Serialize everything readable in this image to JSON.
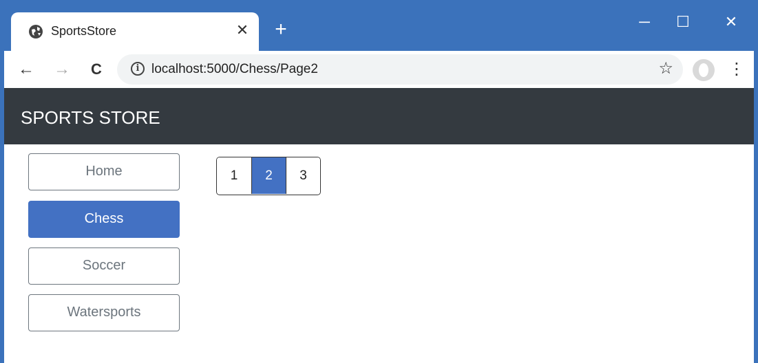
{
  "browser": {
    "tab_title": "SportsStore",
    "tab_close": "✕",
    "new_tab": "+",
    "url": "localhost:5000/Chess/Page2",
    "window_controls": {
      "minimize": "─",
      "maximize": "☐",
      "close": "✕"
    },
    "nav": {
      "back": "←",
      "forward": "→",
      "reload": "C"
    },
    "info_glyph": "i",
    "star_glyph": "☆",
    "menu_glyph": "⋮",
    "colors": {
      "frame": "#3b72bb",
      "tab": "#ffffff",
      "omnibox": "#f1f3f4"
    }
  },
  "site": {
    "brand": "SPORTS STORE",
    "header_color": "#343a40",
    "accent": "#4371c3",
    "categories": [
      {
        "label": "Home",
        "active": false
      },
      {
        "label": "Chess",
        "active": true
      },
      {
        "label": "Soccer",
        "active": false
      },
      {
        "label": "Watersports",
        "active": false
      }
    ],
    "pager": [
      {
        "label": "1",
        "active": false
      },
      {
        "label": "2",
        "active": true
      },
      {
        "label": "3",
        "active": false
      }
    ]
  }
}
